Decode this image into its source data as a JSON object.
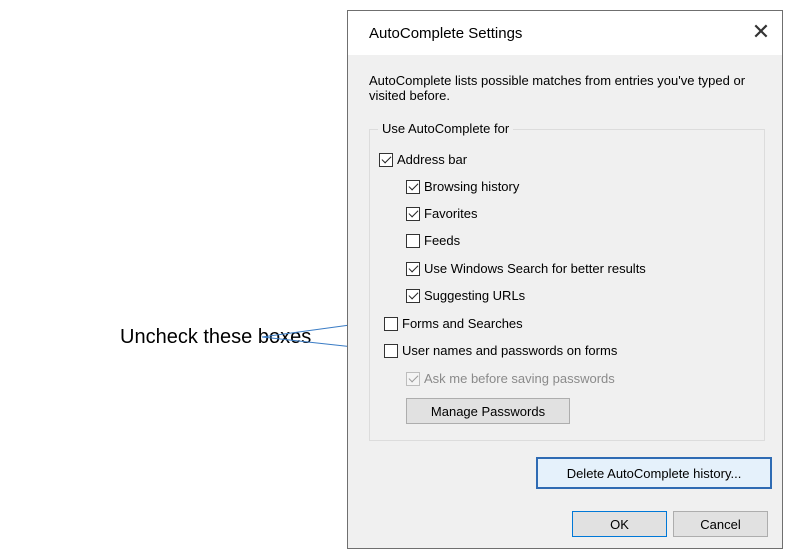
{
  "annotation": {
    "text": "Uncheck these boxes",
    "arrow_color": "#3a7cc5"
  },
  "dialog": {
    "title": "AutoComplete Settings",
    "close_icon": "close-icon",
    "description": "AutoComplete lists possible matches from entries you've typed or visited before.",
    "group_label": "Use AutoComplete for",
    "checkboxes": [
      {
        "label": "Address bar",
        "checked": true,
        "enabled": true
      },
      {
        "label": "Browsing history",
        "checked": true,
        "enabled": true
      },
      {
        "label": "Favorites",
        "checked": true,
        "enabled": true
      },
      {
        "label": "Feeds",
        "checked": false,
        "enabled": true
      },
      {
        "label": "Use Windows Search for better results",
        "checked": true,
        "enabled": true
      },
      {
        "label": "Suggesting URLs",
        "checked": true,
        "enabled": true
      },
      {
        "label": "Forms and Searches",
        "checked": false,
        "enabled": true
      },
      {
        "label": "User names and passwords on forms",
        "checked": false,
        "enabled": true
      },
      {
        "label": "Ask me before saving passwords",
        "checked": true,
        "enabled": false
      }
    ],
    "buttons": {
      "manage_passwords": "Manage Passwords",
      "delete_history": "Delete AutoComplete history...",
      "ok": "OK",
      "cancel": "Cancel"
    }
  },
  "colors": {
    "focus_border": "#2f6bb3",
    "default_border": "#0078d7"
  }
}
